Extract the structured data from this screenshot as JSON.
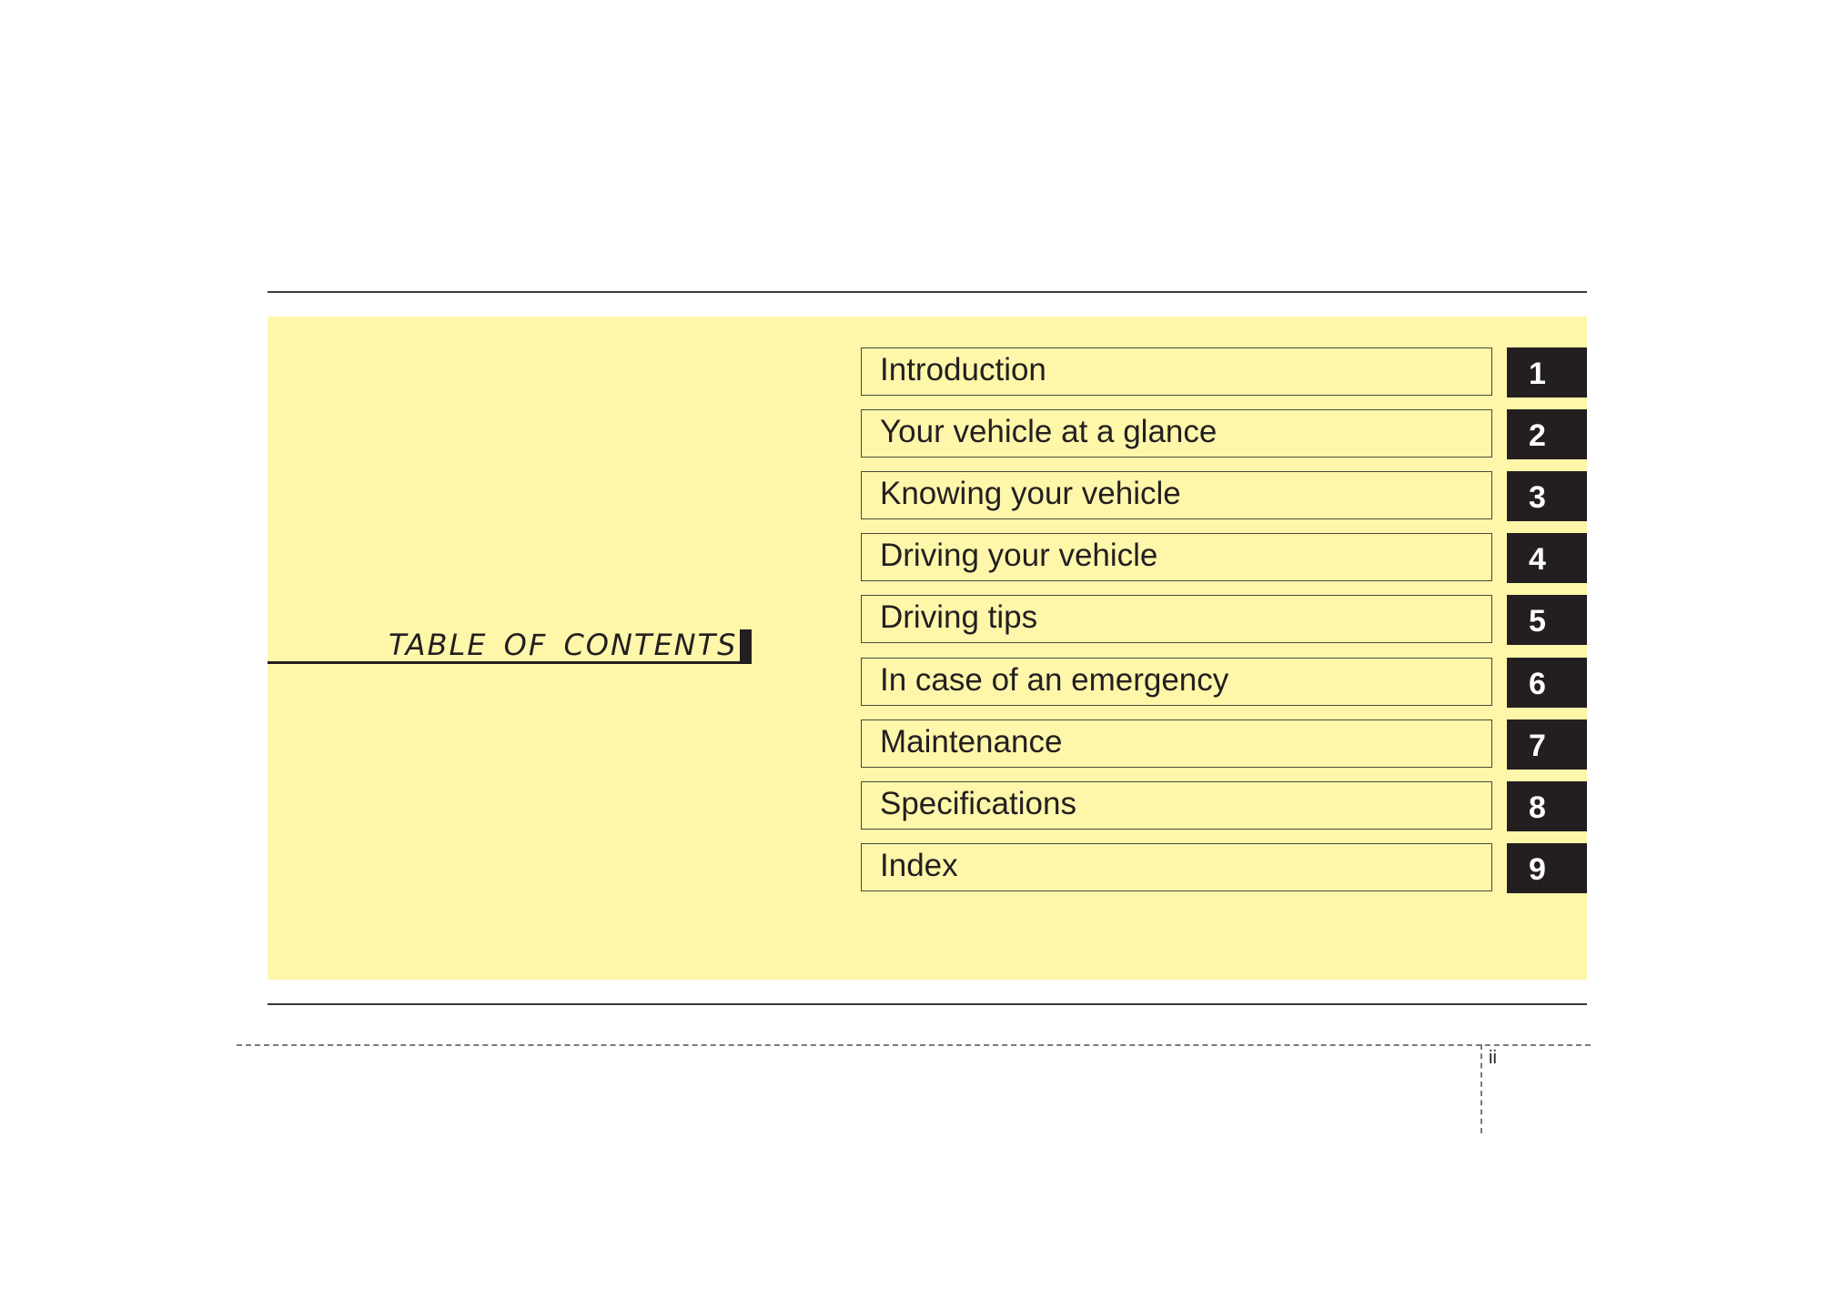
{
  "page": {
    "title": "TABLE OF CONTENTS",
    "page_number": "ii",
    "colors": {
      "panel": "#fef7aa",
      "tab": "#231f20",
      "tab_text": "#ffffff",
      "text": "#231f20"
    }
  },
  "toc": {
    "items": [
      {
        "label": "Introduction",
        "number": "1"
      },
      {
        "label": "Your vehicle at a glance",
        "number": "2"
      },
      {
        "label": "Knowing your vehicle",
        "number": "3"
      },
      {
        "label": "Driving your vehicle",
        "number": "4"
      },
      {
        "label": "Driving tips",
        "number": "5"
      },
      {
        "label": "In case of an emergency",
        "number": "6"
      },
      {
        "label": "Maintenance",
        "number": "7"
      },
      {
        "label": "Specifications",
        "number": "8"
      },
      {
        "label": "Index",
        "number": "9"
      }
    ]
  }
}
